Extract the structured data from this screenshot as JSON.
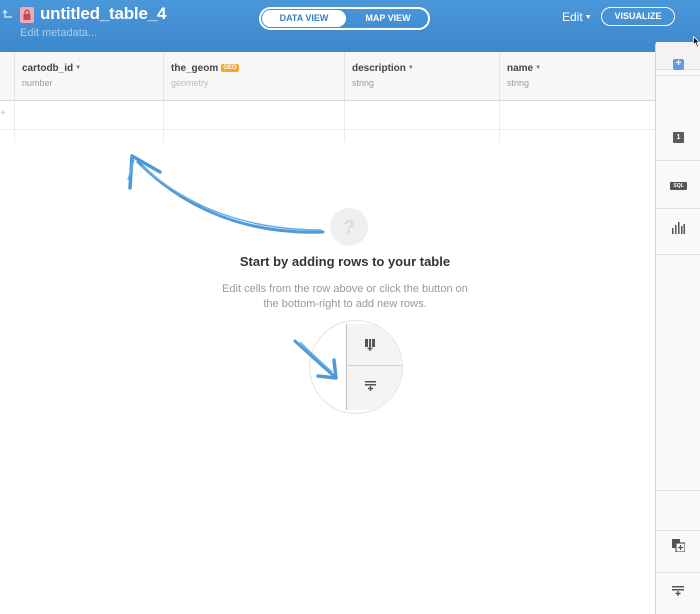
{
  "header": {
    "table_name": "untitled_table_4",
    "edit_metadata": "Edit metadata...",
    "data_view_label": "DATA VIEW",
    "map_view_label": "MAP VIEW",
    "edit_label": "Edit",
    "visualize_label": "VISUALIZE"
  },
  "columns": [
    {
      "name": "cartodb_id",
      "type": "number"
    },
    {
      "name": "the_geom",
      "type": "geometry",
      "badge": "GEO"
    },
    {
      "name": "description",
      "type": "string"
    },
    {
      "name": "name",
      "type": "string"
    }
  ],
  "empty_state": {
    "question_mark": "?",
    "title": "Start by adding rows to your table",
    "description": "Edit cells from the row above or click the button on the bottom-right to add new rows."
  },
  "sidebar": {
    "add_label": "+",
    "one_label": "1",
    "sql_label": "SQL",
    "icons": [
      "add-layer-icon",
      "row-count-icon",
      "sql-icon",
      "chart-icon",
      "merge-tables-icon",
      "add-row-icon",
      "add-column-icon"
    ]
  },
  "colors": {
    "header_blue": "#3d87cc",
    "accent_blue": "#5aa0de",
    "geo_badge": "#f0a735"
  }
}
